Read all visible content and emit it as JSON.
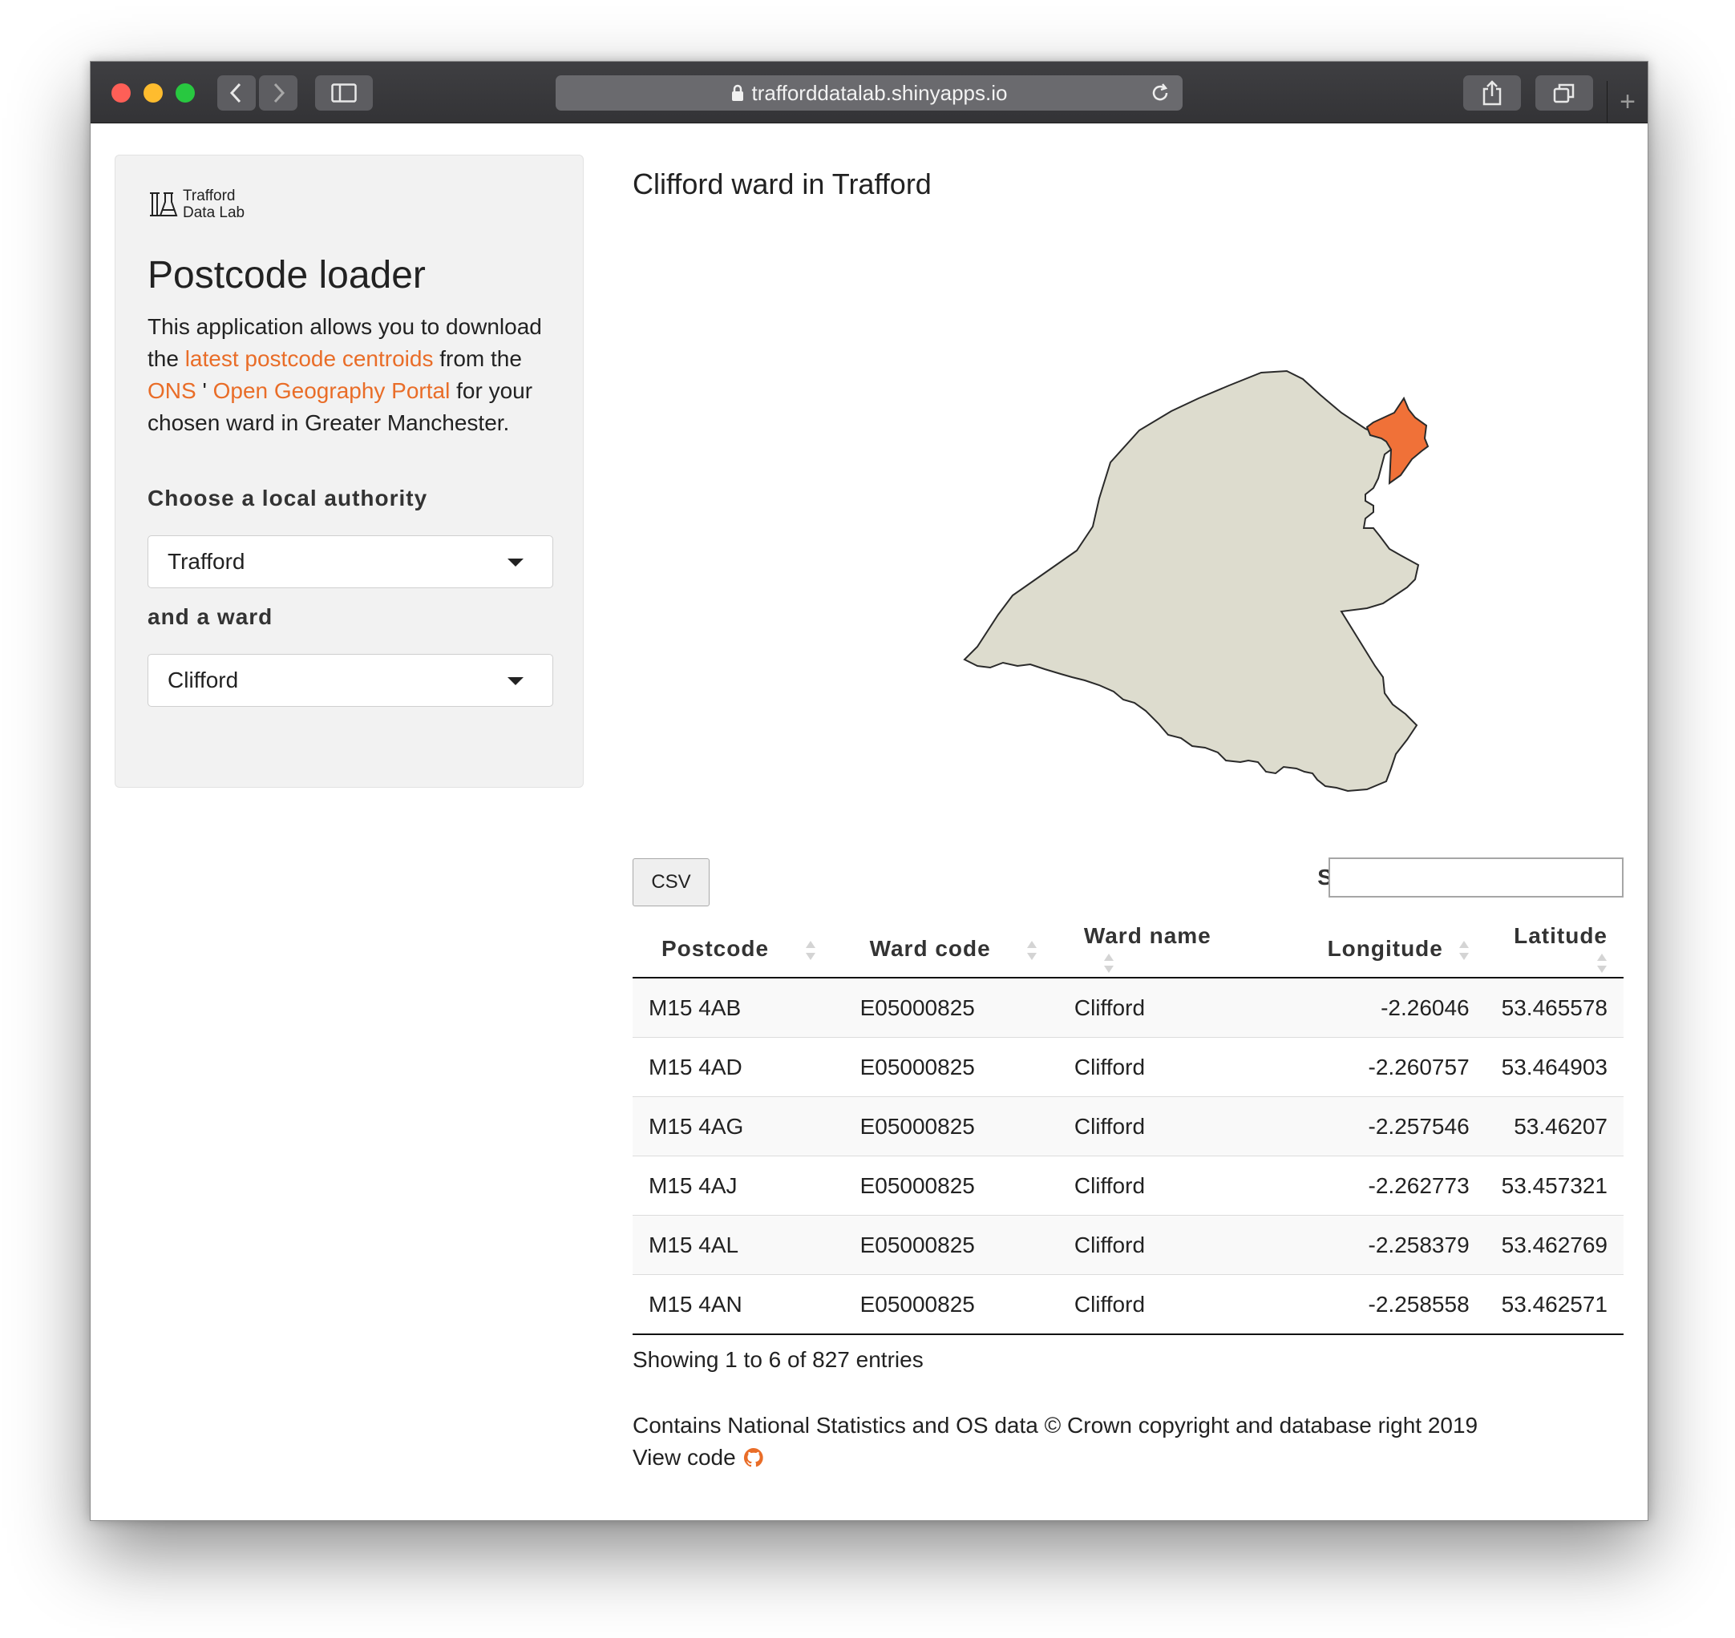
{
  "browser": {
    "url": "trafforddatalab.shinyapps.io"
  },
  "sidebar": {
    "logo_line1": "Trafford",
    "logo_line2": "Data Lab",
    "title": "Postcode loader",
    "intro": {
      "part1": "This application allows you to download the ",
      "link1": "latest postcode centroids",
      "part2": " from the ",
      "link2": "ONS",
      "part3": " ' ",
      "link3": "Open Geography Portal",
      "part4": " for your chosen ward in Greater Manchester."
    },
    "authority_label": "Choose a local authority",
    "authority_value": "Trafford",
    "ward_label": "and a ward",
    "ward_value": "Clifford"
  },
  "main": {
    "map_title": "Clifford ward in Trafford",
    "csv_label": "CSV",
    "search_label": "Search:",
    "search_value": "",
    "columns": [
      "Postcode",
      "Ward code",
      "Ward name",
      "Longitude",
      "Latitude"
    ],
    "rows": [
      [
        "M15 4AB",
        "E05000825",
        "Clifford",
        "-2.26046",
        "53.465578"
      ],
      [
        "M15 4AD",
        "E05000825",
        "Clifford",
        "-2.260757",
        "53.464903"
      ],
      [
        "M15 4AG",
        "E05000825",
        "Clifford",
        "-2.257546",
        "53.46207"
      ],
      [
        "M15 4AJ",
        "E05000825",
        "Clifford",
        "-2.262773",
        "53.457321"
      ],
      [
        "M15 4AL",
        "E05000825",
        "Clifford",
        "-2.258379",
        "53.462769"
      ],
      [
        "M15 4AN",
        "E05000825",
        "Clifford",
        "-2.258558",
        "53.462571"
      ]
    ],
    "info": "Showing 1 to 6 of 827 entries",
    "credit": "Contains National Statistics and OS data © Crown copyright and database right 2019",
    "view_code": "View code"
  },
  "colors": {
    "accent": "#e96d28",
    "map_fill": "#dddcce",
    "ward_highlight": "#f07138"
  }
}
